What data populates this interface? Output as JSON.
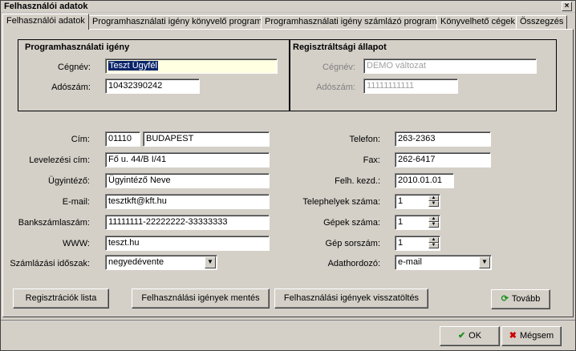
{
  "window": {
    "title": "Felhasználói adatok",
    "close_label": "×"
  },
  "tabs": [
    {
      "label": "Felhasználói adatok"
    },
    {
      "label": "Programhasználati igény könyvelő programok"
    },
    {
      "label": "Programhasználati igény számlázó programok"
    },
    {
      "label": "Könyvelhető cégek"
    },
    {
      "label": "Összegzés"
    }
  ],
  "program_request": {
    "title": "Programhasználati igény",
    "company_label": "Cégnév:",
    "company_value": "Teszt Ügyfél",
    "tax_label": "Adószám:",
    "tax_value": "10432390242"
  },
  "registration": {
    "title": "Regisztráltsági állapot",
    "company_label": "Cégnév:",
    "company_value": "DEMO változat",
    "tax_label": "Adószám:",
    "tax_value": "11111111111"
  },
  "form": {
    "address_label": "Cím:",
    "zip": "01110",
    "city": "BUDAPEST",
    "mail_label": "Levelezési cím:",
    "mail_value": "Fő u. 44/B I/41",
    "agent_label": "Ügyintéző:",
    "agent_value": "Ügyintéző Neve",
    "email_label": "E-mail:",
    "email_value": "tesztkft@kft.hu",
    "bank_label": "Bankszámlaszám:",
    "bank_value": "11111111-22222222-33333333",
    "www_label": "WWW:",
    "www_value": "teszt.hu",
    "period_label": "Számlázási időszak:",
    "period_value": "negyedévente",
    "phone_label": "Telefon:",
    "phone_value": "263-2363",
    "fax_label": "Fax:",
    "fax_value": "262-6417",
    "start_label": "Felh. kezd.:",
    "start_value": "2010.01.01",
    "sites_label": "Telephelyek száma:",
    "sites_value": "1",
    "machines_label": "Gépek száma:",
    "machines_value": "1",
    "serial_label": "Gép sorszám:",
    "serial_value": "1",
    "medium_label": "Adathordozó:",
    "medium_value": "e-mail"
  },
  "buttons": {
    "reg_list": "Regisztrációk lista",
    "save": "Felhasználási igények mentés",
    "reload": "Felhasználási igények visszatöltés",
    "next": "Tovább",
    "ok": "OK",
    "cancel": "Mégsem"
  },
  "icons": {
    "arrow_down": "▼",
    "spin_up": "▲",
    "spin_down": "▼",
    "refresh": "⟳",
    "check": "✔",
    "cross": "✖"
  },
  "colors": {
    "ok_check": "#1a8f1a",
    "cancel_x": "#cc0000",
    "refresh": "#1a8f1a"
  }
}
